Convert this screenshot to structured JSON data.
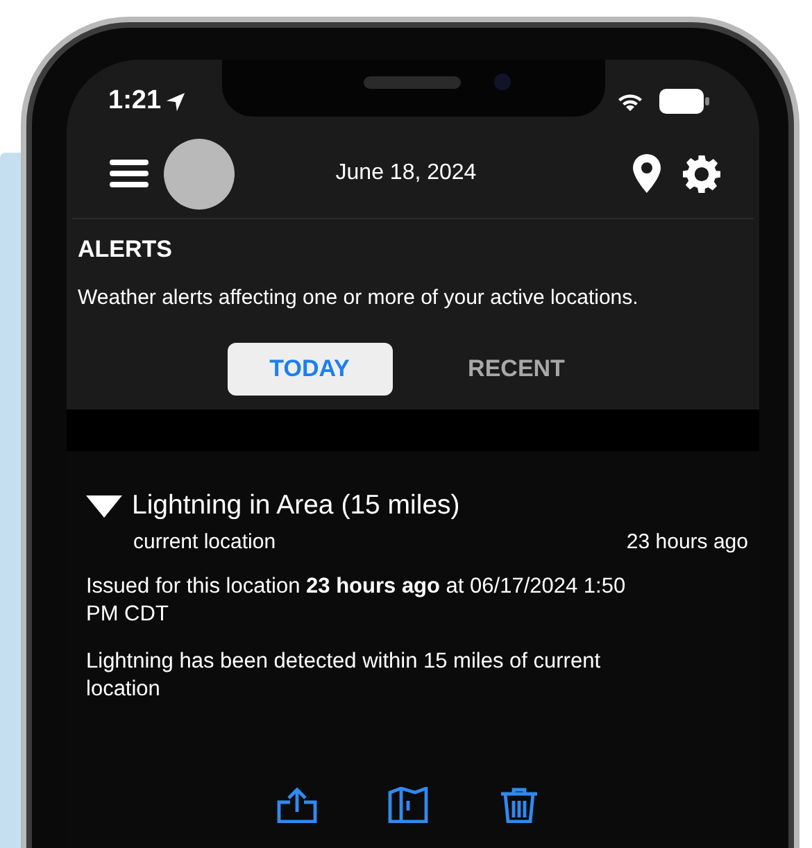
{
  "status_bar": {
    "time": "1:21"
  },
  "header": {
    "date": "June 18, 2024"
  },
  "section": {
    "title": "ALERTS",
    "description": "Weather alerts affecting one or more of your active locations."
  },
  "tabs": [
    {
      "label": "TODAY",
      "selected": true
    },
    {
      "label": "RECENT",
      "selected": false
    }
  ],
  "alerts": [
    {
      "title": "Lightning in Area (15 miles)",
      "expanded": true,
      "location": "current location",
      "age": "23 hours ago",
      "issued": "Issued for this location **23 hours ago** at 06/17/2024 1:50 PM CDT",
      "description": "Lightning has been detected within 15 miles of current location"
    }
  ]
}
